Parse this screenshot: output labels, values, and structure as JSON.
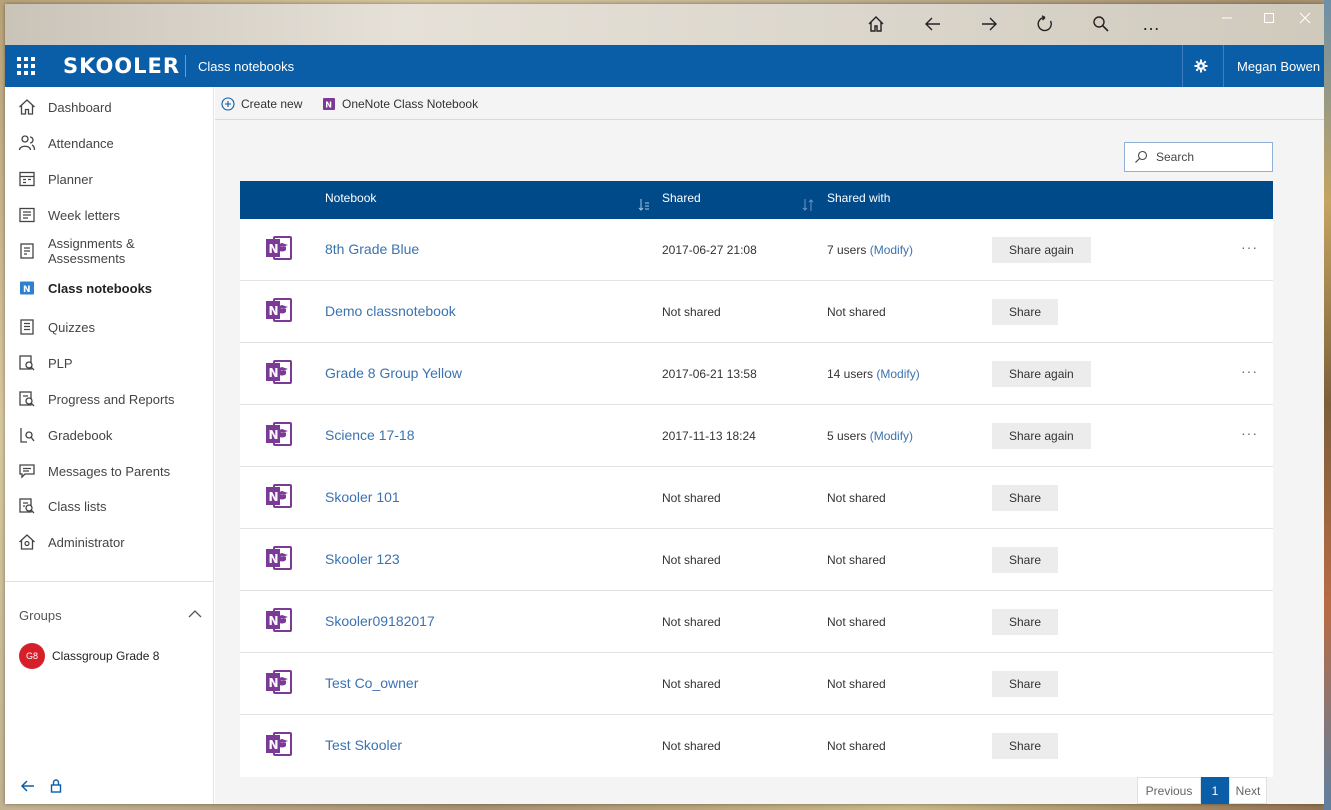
{
  "titlebar": {
    "icons": [
      "home-icon",
      "back-icon",
      "forward-icon",
      "refresh-icon",
      "search-icon",
      "more-icon"
    ],
    "more_label": "…",
    "window_controls": [
      "minimize",
      "maximize",
      "close"
    ]
  },
  "header": {
    "brand": "SKOOLER",
    "section": "Class notebooks",
    "user": "Megan Bowen"
  },
  "sidebar": {
    "items": [
      {
        "label": "Dashboard",
        "icon": "home-icon"
      },
      {
        "label": "Attendance",
        "icon": "people-icon"
      },
      {
        "label": "Planner",
        "icon": "planner-icon"
      },
      {
        "label": "Week letters",
        "icon": "letter-icon"
      },
      {
        "label": "Assignments & Assessments",
        "icon": "assignment-icon"
      },
      {
        "label": "Class notebooks",
        "icon": "onenote-icon",
        "active": true
      },
      {
        "label": "Quizzes",
        "icon": "quiz-icon"
      },
      {
        "label": "PLP",
        "icon": "plp-icon"
      },
      {
        "label": "Progress and Reports",
        "icon": "report-icon"
      },
      {
        "label": "Gradebook",
        "icon": "gradebook-icon"
      },
      {
        "label": "Messages to Parents",
        "icon": "message-icon"
      },
      {
        "label": "Class lists",
        "icon": "classlist-icon"
      },
      {
        "label": "Administrator",
        "icon": "admin-icon"
      }
    ],
    "groups_title": "Groups",
    "group": {
      "avatar": "G8",
      "label": "Classgroup Grade 8"
    }
  },
  "toolbar": {
    "create_new": "Create new",
    "onenote": "OneNote Class Notebook"
  },
  "search": {
    "placeholder": "Search"
  },
  "table": {
    "columns": {
      "notebook": "Notebook",
      "shared": "Shared",
      "shared_with": "Shared with"
    },
    "rows": [
      {
        "name": "8th Grade Blue",
        "shared": "2017-06-27 21:08",
        "with_count": "7 users",
        "modify": "(Modify)",
        "action": "Share again",
        "more": "···"
      },
      {
        "name": "Demo classnotebook",
        "shared": "Not shared",
        "with_count": "Not shared",
        "modify": "",
        "action": "Share",
        "more": ""
      },
      {
        "name": "Grade 8 Group Yellow",
        "shared": "2017-06-21 13:58",
        "with_count": "14 users",
        "modify": "(Modify)",
        "action": "Share again",
        "more": "···"
      },
      {
        "name": "Science 17-18",
        "shared": "2017-11-13 18:24",
        "with_count": "5 users",
        "modify": "(Modify)",
        "action": "Share again",
        "more": "···"
      },
      {
        "name": "Skooler 101",
        "shared": "Not shared",
        "with_count": "Not shared",
        "modify": "",
        "action": "Share",
        "more": ""
      },
      {
        "name": "Skooler 123",
        "shared": "Not shared",
        "with_count": "Not shared",
        "modify": "",
        "action": "Share",
        "more": ""
      },
      {
        "name": "Skooler09182017",
        "shared": "Not shared",
        "with_count": "Not shared",
        "modify": "",
        "action": "Share",
        "more": ""
      },
      {
        "name": "Test Co_owner",
        "shared": "Not shared",
        "with_count": "Not shared",
        "modify": "",
        "action": "Share",
        "more": ""
      },
      {
        "name": "Test Skooler",
        "shared": "Not shared",
        "with_count": "Not shared",
        "modify": "",
        "action": "Share",
        "more": ""
      }
    ]
  },
  "pager": {
    "previous": "Previous",
    "current": "1",
    "next": "Next"
  },
  "colors": {
    "brand_blue": "#0a5da7",
    "table_header": "#004a8a",
    "link": "#3b73b0",
    "onenote": "#7b3a96"
  }
}
